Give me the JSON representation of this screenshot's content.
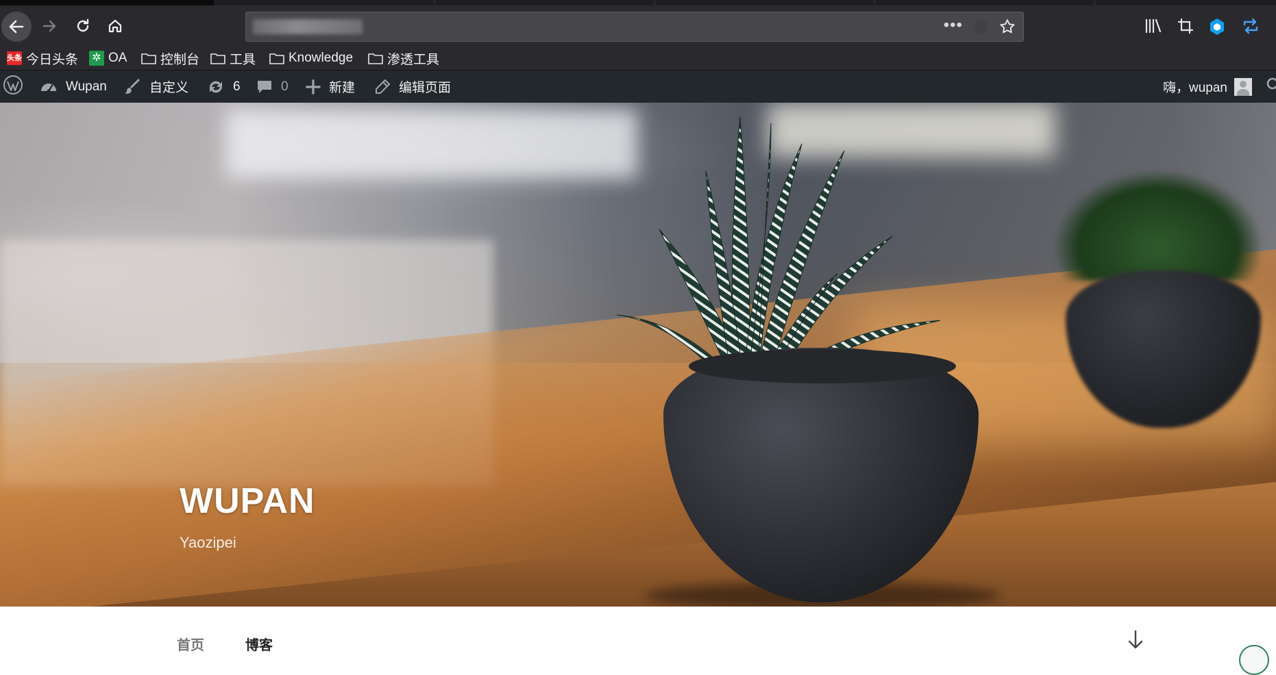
{
  "browser": {
    "url": "",
    "icons": [
      "back-arrow-icon",
      "forward-arrow-icon",
      "reload-icon",
      "home-icon",
      "more-icon",
      "tracking-shield-icon",
      "star-icon",
      "library-icon",
      "screenshot-crop-icon",
      "extension-hex-icon",
      "sync-icon"
    ]
  },
  "bookmarks": [
    {
      "label": "今日头条",
      "icon": "toutiao-icon",
      "icon_text": "头条"
    },
    {
      "label": "OA",
      "icon": "oa-icon"
    },
    {
      "label": "控制台",
      "icon": "folder-icon"
    },
    {
      "label": "工具",
      "icon": "folder-icon"
    },
    {
      "label": "Knowledge",
      "icon": "folder-icon"
    },
    {
      "label": "渗透工具",
      "icon": "folder-icon"
    }
  ],
  "adminbar": {
    "site_name": "Wupan",
    "customize": "自定义",
    "updates_count": "6",
    "comments_count": "0",
    "new_label": "新建",
    "edit_page": "编辑页面",
    "greeting": "嗨，wupan"
  },
  "hero": {
    "title": "WUPAN",
    "subtitle": "Yaozipei"
  },
  "sitenav": {
    "items": [
      "首页",
      "博客"
    ]
  },
  "colors": {
    "browser_chrome": "#2a2a2e",
    "adminbar": "#23282d",
    "extension_accent": "#0a84ff",
    "sync_accent": "#45a1ff"
  }
}
